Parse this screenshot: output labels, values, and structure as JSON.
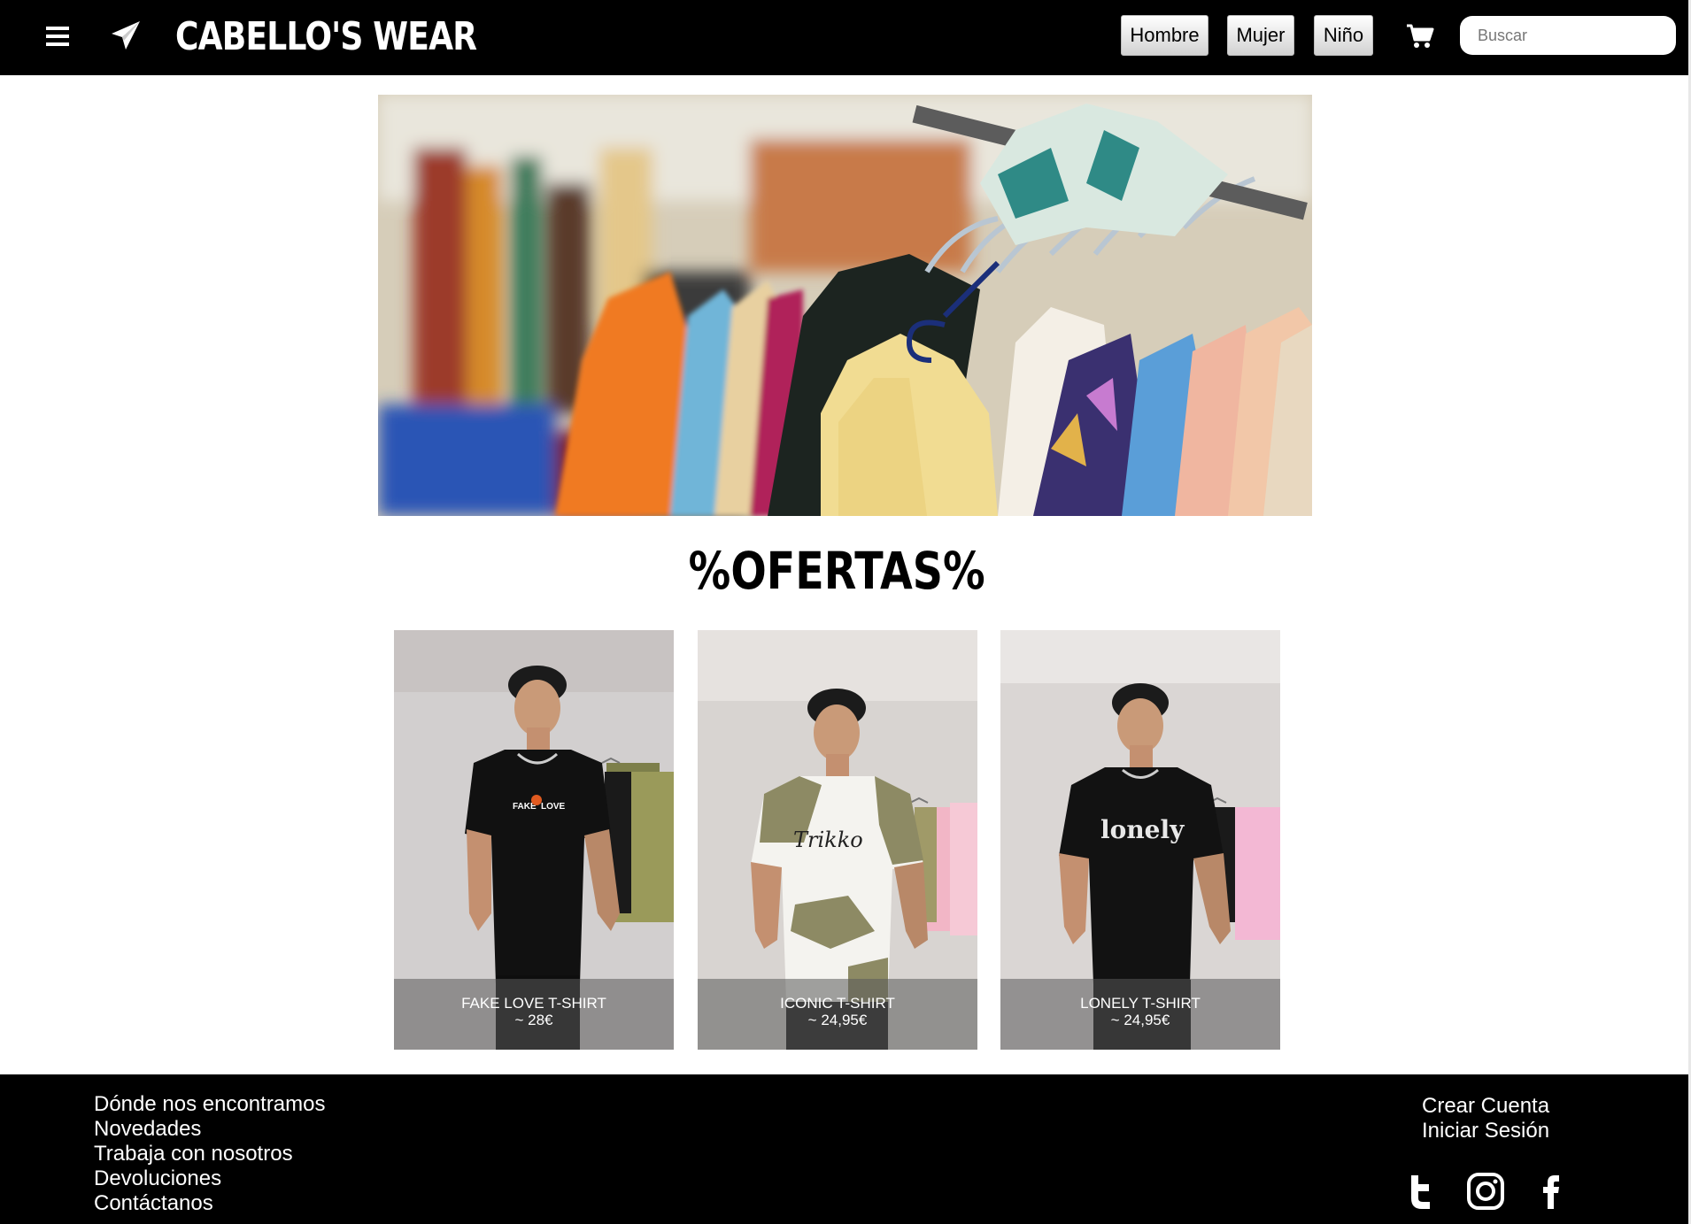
{
  "navbar": {
    "brand": "CABELLO'S WEAR",
    "categories": [
      "Hombre",
      "Mujer",
      "Niño"
    ],
    "search_placeholder": "Buscar",
    "icons": [
      "menu-icon",
      "paper-plane-icon",
      "cart-icon"
    ],
    "background": "#000000"
  },
  "offers": {
    "title": "%OFERTAS%",
    "products": [
      {
        "name": "FAKE LOVE T-SHIRT",
        "price": "~ 28€"
      },
      {
        "name": "ICONIC T-SHIRT",
        "price": "~ 24,95€"
      },
      {
        "name": "LONELY T-SHIRT",
        "price": "~ 24,95€"
      }
    ]
  },
  "footer": {
    "links": [
      "Dónde nos encontramos",
      "Novedades",
      "Trabaja con nosotros",
      "Devoluciones",
      "Contáctanos"
    ],
    "account": [
      "Crear Cuenta",
      "Iniciar Sesión"
    ],
    "social_icons": [
      "twitter-icon",
      "instagram-icon",
      "facebook-icon"
    ]
  }
}
